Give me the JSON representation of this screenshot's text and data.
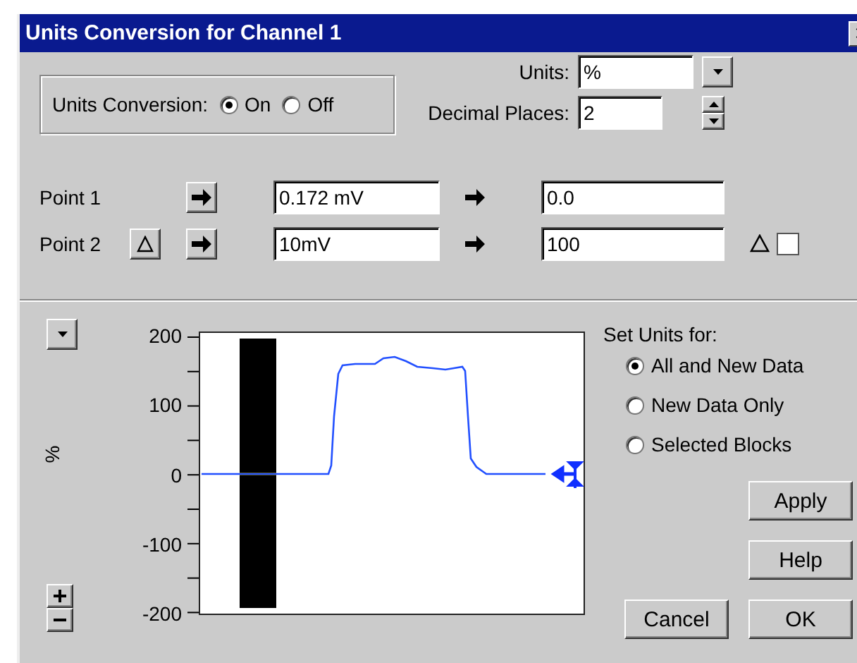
{
  "window": {
    "title": "Units Conversion for Channel 1"
  },
  "units_conversion": {
    "label": "Units Conversion:",
    "options": [
      {
        "label": "On",
        "selected": true
      },
      {
        "label": "Off",
        "selected": false
      }
    ]
  },
  "units": {
    "label": "Units:",
    "value": "%"
  },
  "decimal_places": {
    "label": "Decimal Places:",
    "value": "2"
  },
  "points": [
    {
      "label": "Point 1",
      "input": "0.172 mV",
      "output": "0.0"
    },
    {
      "label": "Point 2",
      "input": "10mV",
      "output": "100",
      "delta": {
        "checked": false
      }
    }
  ],
  "plot": {
    "axis_unit": "%",
    "y_labels": [
      "200",
      "100",
      "0",
      "-100",
      "-200"
    ]
  },
  "set_units_for": {
    "label": "Set Units for:",
    "options": [
      {
        "label": "All and New Data",
        "selected": true
      },
      {
        "label": "New Data Only",
        "selected": false
      },
      {
        "label": "Selected Blocks",
        "selected": false
      }
    ]
  },
  "buttons": [
    {
      "label": "Apply"
    },
    {
      "label": "Help"
    },
    {
      "label": "Cancel"
    },
    {
      "label": "OK"
    }
  ]
}
